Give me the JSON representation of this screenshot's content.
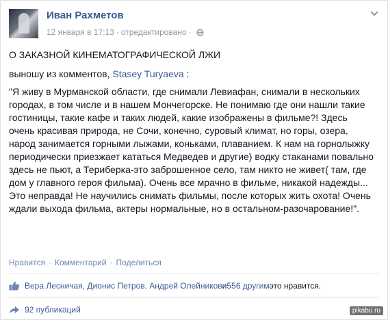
{
  "post": {
    "author": "Иван Рахметов",
    "date": "12 января в 17:13",
    "meta_sep": "·",
    "edited": "отредактировано",
    "title": "О ЗАКАЗНОЙ КИНЕМАТОГРАФИЧЕСКОЙ ЛЖИ",
    "intro_text": "выношу из комментов, ",
    "mention": "Stasey Turyaeva",
    "intro_suffix": " :",
    "body": "\"Я живу в Мурманской области, где снимали Левиафан, снимали в нескольких городах, в том числе и в нашем Мончегорске. Не понимаю где они нашли такие гостиницы, такие кафе и таких людей, какие изображены в фильме?! Здесь очень красивая природа, не Сочи, конечно, суровый климат, но горы, озера, народ занимается горными лыжами, коньками, плаванием. К нам на горнолыжку периодически приезжает кататься Медведев и другие) водку стаканами повально здесь не пьют, а Териберка-это заброшенное село, там никто не живет( там, где дом у главного героя фильма). Очень все мрачно в фильме, никакой надежды... Это неправда! Не научились снимать фильмы, после которых жить охота! Очень ждали выхода фильма, актеры нормальные, но в остальном-разочарование!\"."
  },
  "actions": {
    "like": "Нравится",
    "comment": "Комментарий",
    "share": "Поделиться",
    "sep": "·"
  },
  "likes": {
    "names": "Вера Лесничая, Дионис Петров, Андрей Олейников",
    "conj": " и ",
    "others": "556 другим",
    "suffix": " это нравится."
  },
  "shares": {
    "label": "92 публикаций"
  },
  "watermark": "pikabu.ru",
  "colors": {
    "link": "#3b5998",
    "action": "#6d84b4",
    "muted": "#9197a3",
    "text": "#141823"
  }
}
